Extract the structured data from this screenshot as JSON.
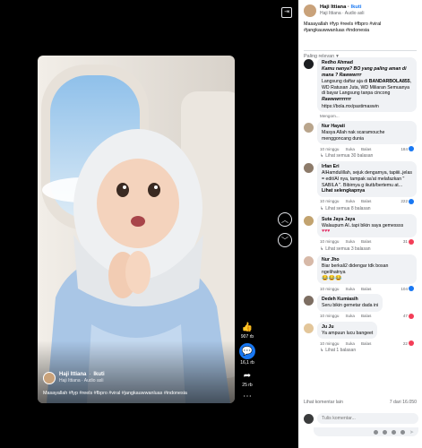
{
  "post": {
    "author": "Haji Ittiana",
    "follow_label": "Ikuti",
    "audio": "Haji Ittiana · Audio asli",
    "caption": "Masayallah #fyp #reels #fbpro #viral #jangkauwwanluas #indonesia"
  },
  "video": {
    "likes": "907 rb",
    "comments": "16,1 rb",
    "shares": "25 rb"
  },
  "sort": {
    "label": "Paling relevan"
  },
  "comments": [
    {
      "author": "Redho Ahmad",
      "text_em": "Kamu nanya? BO yang paling aman di mana ? Rawwwrrr",
      "text": "Langsung daftar aja di",
      "text_strong": "BANDARBOLA855",
      "text_rest": ", WD Ratusan Juta, WD Miliaran Semuanya di bayar Langsung tanpa cincong",
      "text_em2": "Rawwwrrrrrrr",
      "link": "https://bola.mx/pastimaswin",
      "time": "Mengom..."
    },
    {
      "author": "Nur Hayati",
      "text": "Masya Allah nak scaramouche menggoncang dunia",
      "time": "10 minggu",
      "like": "Suka",
      "reply": "Balas",
      "count": "184",
      "replies": "Lihat semua 30 balasan"
    },
    {
      "author": "Irfan Eri",
      "text": "AlHamdulillah, sejuk dengarnya, tapiiii..jelas = edit/AI nya, tampak sa'at melafazkan \" SABILA \". Bibirnya g ikutb/bertemu at...",
      "more": "Lihat selengkapnya",
      "time": "10 minggu",
      "like": "Suka",
      "reply": "Balas",
      "count": "222",
      "replies": "Lihat semua 8 balasan"
    },
    {
      "author": "Suta Jaya Jaya",
      "text": "Walaupum AI..tapi bikin saya gemessss",
      "time": "10 minggu",
      "like": "Suka",
      "reply": "Balas",
      "count": "31",
      "replies": "Lihat semua 3 balasan"
    },
    {
      "author": "Nur Jho",
      "text": "Biar berkali2 didengar tdk bosan ngelihatnya",
      "time": "10 minggu",
      "like": "Suka",
      "reply": "Balas",
      "count": "104"
    },
    {
      "author": "Dedeh Kumiasih",
      "text": "Seru bikin gemetar dada ini",
      "time": "10 minggu",
      "like": "Suka",
      "reply": "Balas",
      "count": "47"
    },
    {
      "author": "Ju Ju",
      "text": "Ya ampuun lucu bangeet",
      "time": "10 minggu",
      "like": "Suka",
      "reply": "Balas",
      "count": "22",
      "replies": "Lihat 1 balasan"
    }
  ],
  "footer": {
    "more_comments": "Lihat komentar lain",
    "count": "7 dari 16.050",
    "placeholder": "Tulis komentar..."
  }
}
